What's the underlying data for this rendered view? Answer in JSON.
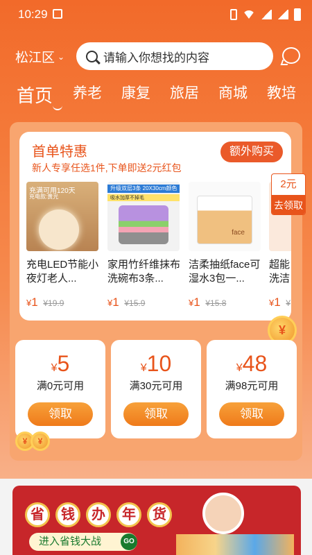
{
  "status_bar": {
    "time": "10:29"
  },
  "header": {
    "location": "松江区",
    "search_placeholder": "请输入你想找的内容"
  },
  "tabs": [
    {
      "label": "首页",
      "active": true
    },
    {
      "label": "养老"
    },
    {
      "label": "康复"
    },
    {
      "label": "旅居"
    },
    {
      "label": "商城"
    },
    {
      "label": "教培"
    }
  ],
  "first_order": {
    "title": "首单特惠",
    "subtitle": "新人专享任选1件,下单即送2元红包",
    "extra_button": "额外购买",
    "products": [
      {
        "name": "充电LED节能小夜灯老人...",
        "price": "1",
        "original": "19.9",
        "img_text": "充满可用120天",
        "img_sub": "充电款:黄光"
      },
      {
        "name": "家用竹纤维抹布洗碗布3条...",
        "price": "1",
        "original": "15.9",
        "img_text": "升级双层3条 20X30cm颜色随机",
        "img_sub": "吸水加厚不掉毛"
      },
      {
        "name": "洁柔抽纸face可湿水3包一...",
        "price": "1",
        "original": "15.8"
      },
      {
        "name": "超能洗洁",
        "price": "1",
        "original": ""
      }
    ],
    "currency": "¥",
    "float_coupon": {
      "amount": "2元",
      "action": "去领取"
    }
  },
  "coupons": [
    {
      "value": "5",
      "condition": "满0元可用",
      "button": "领取"
    },
    {
      "value": "10",
      "condition": "满30元可用",
      "button": "领取"
    },
    {
      "value": "48",
      "condition": "满98元可用",
      "button": "领取"
    }
  ],
  "banner": {
    "title_chars": [
      "省",
      "钱",
      "办",
      "年",
      "货"
    ],
    "cta": "进入省钱大战",
    "go": "GO"
  },
  "colors": {
    "brand": "#f26a2a",
    "accent": "#e8541b",
    "coupon_button": "#ef7a1a"
  }
}
